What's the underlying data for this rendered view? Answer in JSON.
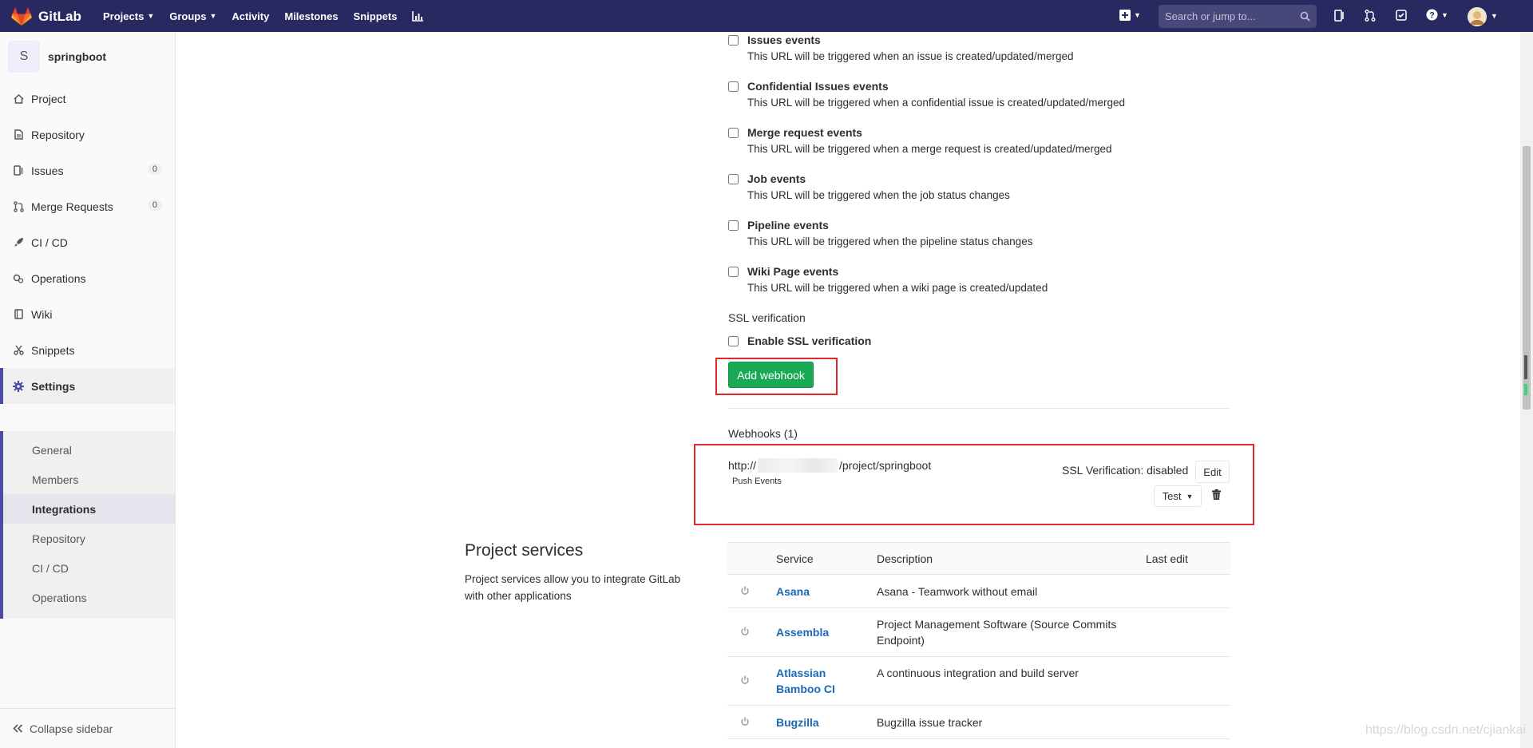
{
  "navbar": {
    "brand": "GitLab",
    "links": [
      {
        "label": "Projects",
        "dropdown": true
      },
      {
        "label": "Groups",
        "dropdown": true
      },
      {
        "label": "Activity",
        "dropdown": false
      },
      {
        "label": "Milestones",
        "dropdown": false
      },
      {
        "label": "Snippets",
        "dropdown": false
      }
    ],
    "search_placeholder": "Search or jump to...",
    "bg_color": "#292961"
  },
  "sidebar": {
    "project_initial": "S",
    "project_name": "springboot",
    "items": [
      {
        "label": "Project",
        "icon": "home-icon"
      },
      {
        "label": "Repository",
        "icon": "doc-icon"
      },
      {
        "label": "Issues",
        "icon": "issues-icon",
        "count": "0"
      },
      {
        "label": "Merge Requests",
        "icon": "merge-request-icon",
        "count": "0"
      },
      {
        "label": "CI / CD",
        "icon": "rocket-icon"
      },
      {
        "label": "Operations",
        "icon": "cloud-gear-icon"
      },
      {
        "label": "Wiki",
        "icon": "book-icon"
      },
      {
        "label": "Snippets",
        "icon": "scissors-icon"
      },
      {
        "label": "Settings",
        "icon": "gear-icon"
      }
    ],
    "settings_sub": [
      "General",
      "Members",
      "Integrations",
      "Repository",
      "CI / CD",
      "Operations"
    ],
    "active_sub": "Integrations",
    "collapse_label": "Collapse sidebar"
  },
  "triggers": [
    {
      "title": "Issues events",
      "desc": "This URL will be triggered when an issue is created/updated/merged"
    },
    {
      "title": "Confidential Issues events",
      "desc": "This URL will be triggered when a confidential issue is created/updated/merged"
    },
    {
      "title": "Merge request events",
      "desc": "This URL will be triggered when a merge request is created/updated/merged"
    },
    {
      "title": "Job events",
      "desc": "This URL will be triggered when the job status changes"
    },
    {
      "title": "Pipeline events",
      "desc": "This URL will be triggered when the pipeline status changes"
    },
    {
      "title": "Wiki Page events",
      "desc": "This URL will be triggered when a wiki page is created/updated"
    }
  ],
  "ssl": {
    "section_label": "SSL verification",
    "checkbox_label": "Enable SSL verification"
  },
  "add_webhook_label": "Add webhook",
  "webhooks": {
    "title": "Webhooks (1)",
    "url_prefix": "http://",
    "url_suffix": "/project/springboot",
    "badge": "Push Events",
    "ssl_status": "SSL Verification: disabled",
    "edit_label": "Edit",
    "test_label": "Test"
  },
  "project_services": {
    "title": "Project services",
    "desc": "Project services allow you to integrate GitLab with other applications",
    "columns": [
      "Service",
      "Description",
      "Last edit"
    ],
    "rows": [
      {
        "name": "Asana",
        "desc": "Asana - Teamwork without email"
      },
      {
        "name": "Assembla",
        "desc": "Project Management Software (Source Commits Endpoint)"
      },
      {
        "name": "Atlassian Bamboo CI",
        "desc": "A continuous integration and build server"
      },
      {
        "name": "Bugzilla",
        "desc": "Bugzilla issue tracker"
      }
    ]
  },
  "watermark": "https://blog.csdn.net/cjiankai",
  "colors": {
    "accent": "#4b4ba3",
    "success": "#1aaa55",
    "link": "#1b69b6",
    "highlight_box": "#e3262c"
  }
}
